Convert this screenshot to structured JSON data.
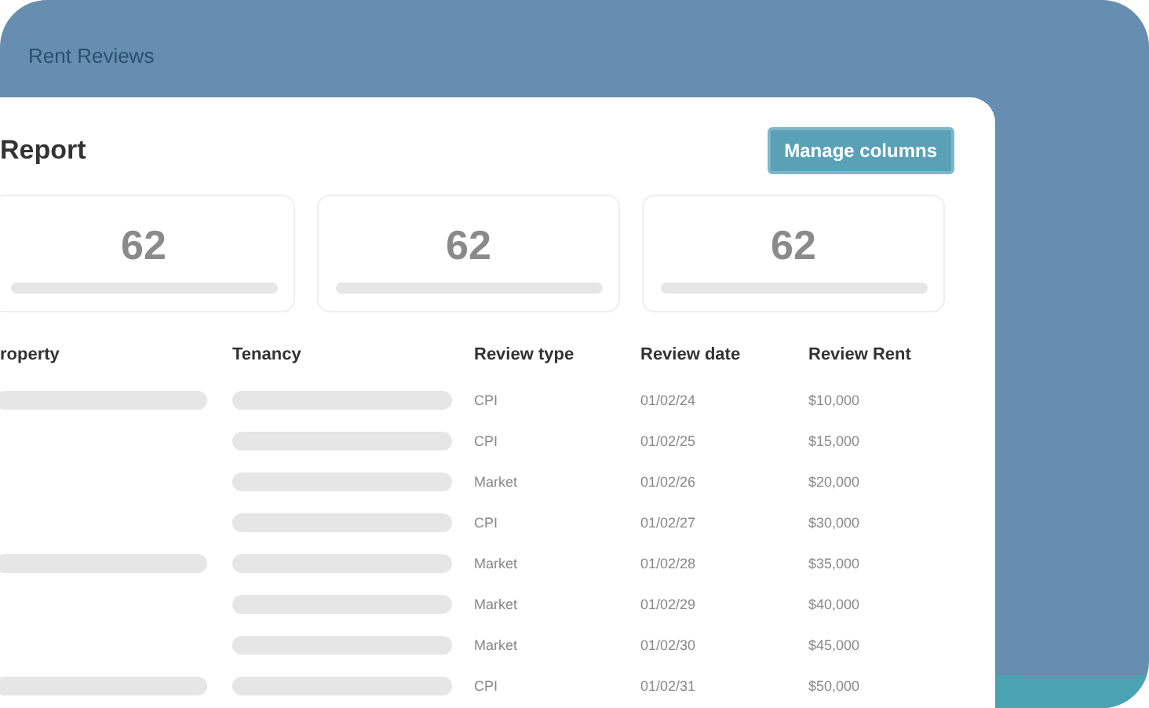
{
  "background_window": {
    "title": "Rent Reviews"
  },
  "report": {
    "title": "Report",
    "button": "Manage columns",
    "stats": [
      {
        "value": "62"
      },
      {
        "value": "62"
      },
      {
        "value": "62"
      }
    ],
    "table": {
      "columns": [
        "roperty",
        "Tenancy",
        "Review type",
        "Review date",
        "Review Rent"
      ],
      "rows": [
        {
          "property_shown": true,
          "review_type": "CPI",
          "review_date": "01/02/24",
          "review_rent": "$10,000"
        },
        {
          "property_shown": false,
          "review_type": "CPI",
          "review_date": "01/02/25",
          "review_rent": "$15,000"
        },
        {
          "property_shown": false,
          "review_type": "Market",
          "review_date": "01/02/26",
          "review_rent": "$20,000"
        },
        {
          "property_shown": false,
          "review_type": "CPI",
          "review_date": "01/02/27",
          "review_rent": "$30,000"
        },
        {
          "property_shown": true,
          "review_type": "Market",
          "review_date": "01/02/28",
          "review_rent": "$35,000"
        },
        {
          "property_shown": false,
          "review_type": "Market",
          "review_date": "01/02/29",
          "review_rent": "$40,000"
        },
        {
          "property_shown": false,
          "review_type": "Market",
          "review_date": "01/02/30",
          "review_rent": "$45,000"
        },
        {
          "property_shown": true,
          "review_type": "CPI",
          "review_date": "01/02/31",
          "review_rent": "$50,000"
        }
      ]
    }
  }
}
